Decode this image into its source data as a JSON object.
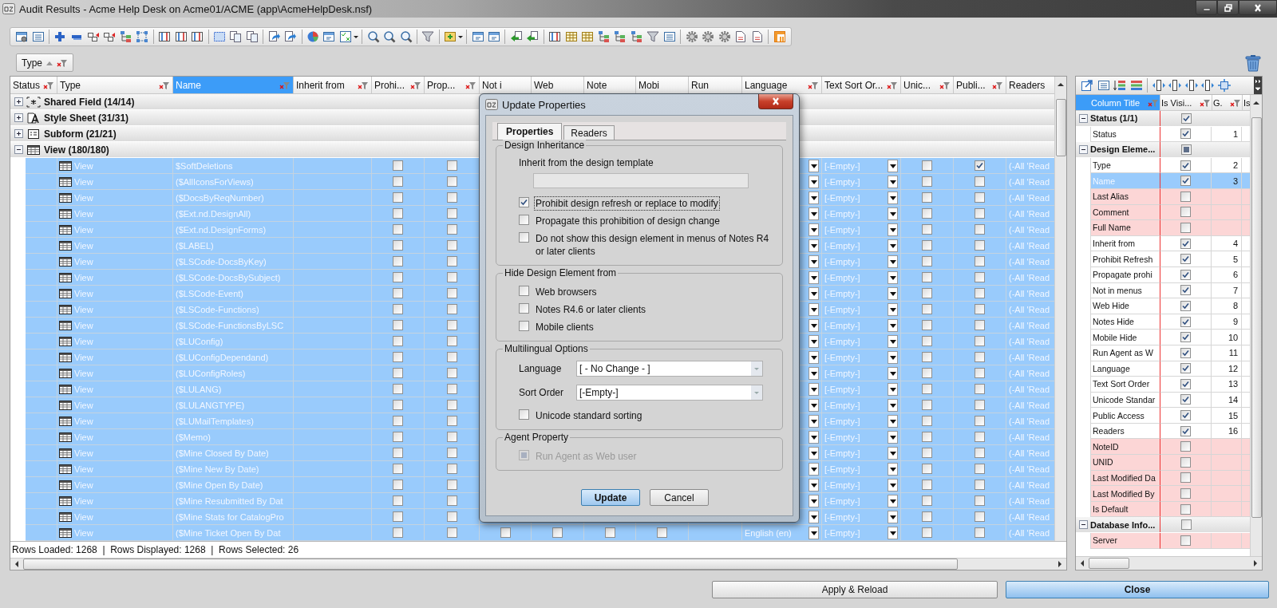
{
  "window": {
    "title": "Audit Results - Acme Help Desk on Acme01/ACME (app\\AcmeHelpDesk.nsf)"
  },
  "group_by": [
    {
      "label": "Type"
    }
  ],
  "table": {
    "columns": [
      {
        "label": "Status",
        "filter": true,
        "selected": false
      },
      {
        "label": "Type",
        "filter": true,
        "selected": false
      },
      {
        "label": "Name",
        "filter": true,
        "selected": true
      },
      {
        "label": "Inherit from",
        "filter": true,
        "selected": false
      },
      {
        "label": "Prohi...",
        "filter": true,
        "selected": false
      },
      {
        "label": "Prop...",
        "filter": true,
        "selected": false
      },
      {
        "label": "Not i",
        "filter": false,
        "selected": false
      },
      {
        "label": "Web",
        "filter": false,
        "selected": false
      },
      {
        "label": "Note",
        "filter": false,
        "selected": false
      },
      {
        "label": "Mobi",
        "filter": false,
        "selected": false
      },
      {
        "label": "Run",
        "filter": false,
        "selected": false
      },
      {
        "label": "Language",
        "filter": true,
        "selected": false
      },
      {
        "label": "Text Sort Or...",
        "filter": true,
        "selected": false
      },
      {
        "label": "Unic...",
        "filter": true,
        "selected": false
      },
      {
        "label": "Publi...",
        "filter": true,
        "selected": false
      },
      {
        "label": "Readers",
        "filter": false,
        "selected": false
      }
    ],
    "groups": [
      {
        "label": "Shared Field (14/14)",
        "expanded": false
      },
      {
        "label": "Style Sheet (31/31)",
        "expanded": false
      },
      {
        "label": "Subform (21/21)",
        "expanded": false
      },
      {
        "label": "View (180/180)",
        "expanded": true,
        "rows": [
          {
            "selected": true,
            "type": "View",
            "name": "$SoftDeletions",
            "prohibit": false,
            "propagate": false,
            "text_sort": "[-Empty-]",
            "unicode": false,
            "public": true,
            "readers": "(-All 'Read"
          },
          {
            "selected": true,
            "type": "View",
            "name": "($AllIconsForViews)",
            "prohibit": false,
            "propagate": false,
            "text_sort": "[-Empty-]",
            "unicode": false,
            "public": false,
            "readers": "(-All 'Read"
          },
          {
            "selected": true,
            "type": "View",
            "name": "($DocsByReqNumber)",
            "prohibit": false,
            "propagate": false,
            "text_sort": "[-Empty-]",
            "unicode": false,
            "public": false,
            "readers": "(-All 'Read"
          },
          {
            "selected": true,
            "type": "View",
            "name": "($Ext.nd.DesignAll)",
            "prohibit": false,
            "propagate": false,
            "text_sort": "[-Empty-]",
            "unicode": false,
            "public": false,
            "readers": "(-All 'Read"
          },
          {
            "selected": true,
            "type": "View",
            "name": "($Ext.nd.DesignForms)",
            "prohibit": false,
            "propagate": false,
            "text_sort": "[-Empty-]",
            "unicode": false,
            "public": false,
            "readers": "(-All 'Read"
          },
          {
            "selected": true,
            "type": "View",
            "name": "($LABEL)",
            "prohibit": false,
            "propagate": false,
            "text_sort": "[-Empty-]",
            "unicode": false,
            "public": false,
            "readers": "(-All 'Read"
          },
          {
            "selected": true,
            "type": "View",
            "name": "($LSCode-DocsByKey)",
            "prohibit": false,
            "propagate": false,
            "text_sort": "[-Empty-]",
            "unicode": false,
            "public": false,
            "readers": "(-All 'Read"
          },
          {
            "selected": true,
            "type": "View",
            "name": "($LSCode-DocsBySubject)",
            "prohibit": false,
            "propagate": false,
            "text_sort": "[-Empty-]",
            "unicode": false,
            "public": false,
            "readers": "(-All 'Read"
          },
          {
            "selected": true,
            "type": "View",
            "name": "($LSCode-Event)",
            "prohibit": false,
            "propagate": false,
            "text_sort": "[-Empty-]",
            "unicode": false,
            "public": false,
            "readers": "(-All 'Read"
          },
          {
            "selected": true,
            "type": "View",
            "name": "($LSCode-Functions)",
            "prohibit": false,
            "propagate": false,
            "text_sort": "[-Empty-]",
            "unicode": false,
            "public": false,
            "readers": "(-All 'Read"
          },
          {
            "selected": true,
            "type": "View",
            "name": "($LSCode-FunctionsByLSC",
            "prohibit": false,
            "propagate": false,
            "text_sort": "[-Empty-]",
            "unicode": false,
            "public": false,
            "readers": "(-All 'Read"
          },
          {
            "selected": true,
            "type": "View",
            "name": "($LUConfig)",
            "prohibit": false,
            "propagate": false,
            "text_sort": "[-Empty-]",
            "unicode": false,
            "public": false,
            "readers": "(-All 'Read"
          },
          {
            "selected": true,
            "type": "View",
            "name": "($LUConfigDependand)",
            "prohibit": false,
            "propagate": false,
            "text_sort": "[-Empty-]",
            "unicode": false,
            "public": false,
            "readers": "(-All 'Read"
          },
          {
            "selected": true,
            "type": "View",
            "name": "($LUConfigRoles)",
            "prohibit": false,
            "propagate": false,
            "text_sort": "[-Empty-]",
            "unicode": false,
            "public": false,
            "readers": "(-All 'Read"
          },
          {
            "selected": true,
            "type": "View",
            "name": "($LULANG)",
            "prohibit": false,
            "propagate": false,
            "text_sort": "[-Empty-]",
            "unicode": false,
            "public": false,
            "readers": "(-All 'Read"
          },
          {
            "selected": true,
            "type": "View",
            "name": "($LULANGTYPE)",
            "prohibit": false,
            "propagate": false,
            "text_sort": "[-Empty-]",
            "unicode": false,
            "public": false,
            "readers": "(-All 'Read"
          },
          {
            "selected": true,
            "type": "View",
            "name": "($LUMailTemplates)",
            "prohibit": false,
            "propagate": false,
            "text_sort": "[-Empty-]",
            "unicode": false,
            "public": false,
            "readers": "(-All 'Read"
          },
          {
            "selected": true,
            "type": "View",
            "name": "($Memo)",
            "prohibit": false,
            "propagate": false,
            "text_sort": "[-Empty-]",
            "unicode": false,
            "public": false,
            "readers": "(-All 'Read"
          },
          {
            "selected": true,
            "type": "View",
            "name": "($Mine Closed By Date)",
            "prohibit": false,
            "propagate": false,
            "text_sort": "[-Empty-]",
            "unicode": false,
            "public": false,
            "readers": "(-All 'Read"
          },
          {
            "selected": true,
            "type": "View",
            "name": "($Mine New By Date)",
            "prohibit": false,
            "propagate": false,
            "text_sort": "[-Empty-]",
            "unicode": false,
            "public": false,
            "readers": "(-All 'Read"
          },
          {
            "selected": true,
            "type": "View",
            "name": "($Mine Open By Date)",
            "prohibit": false,
            "propagate": false,
            "text_sort": "[-Empty-]",
            "unicode": false,
            "public": false,
            "readers": "(-All 'Read"
          },
          {
            "selected": true,
            "type": "View",
            "name": "($Mine Resubmitted By Dat",
            "prohibit": false,
            "propagate": false,
            "text_sort": "[-Empty-]",
            "unicode": false,
            "public": false,
            "readers": "(-All 'Read"
          },
          {
            "selected": true,
            "type": "View",
            "name": "($Mine Stats for CatalogPro",
            "prohibit": false,
            "propagate": false,
            "text_sort": "[-Empty-]",
            "unicode": false,
            "public": false,
            "readers": "(-All 'Read"
          },
          {
            "selected": true,
            "type": "View",
            "name": "($Mine Ticket Open By Dat",
            "prohibit": false,
            "propagate": false,
            "not_in_menus": false,
            "web_hide": false,
            "notes_hide": false,
            "mobile_hide": false,
            "language": "English (en)",
            "text_sort": "[-Empty-]",
            "unicode": false,
            "public": false,
            "readers": "(-All 'Read"
          }
        ]
      }
    ],
    "status": "Rows Loaded: 1268  |  Rows Displayed: 1268  |  Rows Selected: 26"
  },
  "columns_panel": {
    "columns": [
      {
        "label": "Column Title",
        "filter": true,
        "selected": true
      },
      {
        "label": "Is Visi...",
        "filter": true,
        "selected": false
      },
      {
        "label": "G.",
        "filter": true,
        "selected": false
      },
      {
        "label": "Is",
        "selected": false
      }
    ],
    "groups": [
      {
        "label": "Status (1/1)",
        "expanded": true,
        "checked": true,
        "mixed": false,
        "children": [
          {
            "label": "Status",
            "visible": true,
            "order": "1",
            "selected": false
          }
        ]
      },
      {
        "label": "Design Eleme...",
        "expanded": true,
        "checked": false,
        "mixed": true,
        "children": [
          {
            "label": "Type",
            "visible": true,
            "order": "2",
            "selected": false
          },
          {
            "label": "Name",
            "visible": true,
            "order": "3",
            "selected": true
          },
          {
            "label": "Last Alias",
            "visible": false,
            "selected": false
          },
          {
            "label": "Comment",
            "visible": false,
            "selected": false
          },
          {
            "label": "Full Name",
            "visible": false,
            "selected": false
          },
          {
            "label": "Inherit from",
            "visible": true,
            "order": "4",
            "selected": false
          },
          {
            "label": "Prohibit Refresh",
            "visible": true,
            "order": "5",
            "selected": false
          },
          {
            "label": "Propagate prohi",
            "visible": true,
            "order": "6",
            "selected": false
          },
          {
            "label": "Not in menus",
            "visible": true,
            "order": "7",
            "selected": false
          },
          {
            "label": "Web Hide",
            "visible": true,
            "order": "8",
            "selected": false
          },
          {
            "label": "Notes Hide",
            "visible": true,
            "order": "9",
            "selected": false
          },
          {
            "label": "Mobile Hide",
            "visible": true,
            "order": "10",
            "selected": false
          },
          {
            "label": "Run Agent as W",
            "visible": true,
            "order": "11",
            "selected": false
          },
          {
            "label": "Language",
            "visible": true,
            "order": "12",
            "selected": false
          },
          {
            "label": "Text Sort Order",
            "visible": true,
            "order": "13",
            "selected": false
          },
          {
            "label": "Unicode Standar",
            "visible": true,
            "order": "14",
            "selected": false
          },
          {
            "label": "Public Access",
            "visible": true,
            "order": "15",
            "selected": false
          },
          {
            "label": "Readers",
            "visible": true,
            "order": "16",
            "selected": false
          },
          {
            "label": "NoteID",
            "visible": false,
            "selected": false
          },
          {
            "label": "UNID",
            "visible": false,
            "selected": false
          },
          {
            "label": "Last Modified Da",
            "visible": false,
            "selected": false
          },
          {
            "label": "Last Modified By",
            "visible": false,
            "selected": false
          },
          {
            "label": "Is Default",
            "visible": false,
            "selected": false
          }
        ]
      },
      {
        "label": "Database Info...",
        "expanded": true,
        "checked": false,
        "mixed": false,
        "children": [
          {
            "label": "Server",
            "visible": false,
            "selected": false
          }
        ]
      }
    ]
  },
  "dialog": {
    "title": "Update Properties",
    "tabs": [
      {
        "label": "Properties",
        "selected": true
      },
      {
        "label": "Readers",
        "selected": false
      }
    ],
    "sections": [
      {
        "title": "Design Inheritance",
        "items": [
          {
            "kind": "field",
            "label": "Inherit from the design template"
          },
          {
            "kind": "checkbox",
            "label": "Prohibit design refresh or replace to modify",
            "checked": true,
            "disabled": false,
            "focused": true
          },
          {
            "kind": "checkbox",
            "label": "Propagate this prohibition of design change",
            "checked": false,
            "disabled": false,
            "focused": false
          },
          {
            "kind": "checkbox",
            "label": "Do not show this design element in menus of Notes R4 or later clients",
            "checked": false,
            "disabled": false,
            "focused": false
          }
        ]
      },
      {
        "title": "Hide Design Element from",
        "items": [
          {
            "kind": "checkbox",
            "label": "Web browsers",
            "checked": false,
            "disabled": false,
            "focused": false
          },
          {
            "kind": "checkbox",
            "label": "Notes R4.6 or later clients",
            "checked": false,
            "disabled": false,
            "focused": false
          },
          {
            "kind": "checkbox",
            "label": "Mobile clients",
            "checked": false,
            "disabled": false,
            "focused": false
          }
        ]
      },
      {
        "title": "Multilingual Options",
        "items": [
          {
            "kind": "select",
            "label": "Language",
            "value": "[ - No Change - ]"
          },
          {
            "kind": "select",
            "label": "Sort Order",
            "value": "[-Empty-]"
          },
          {
            "kind": "checkbox",
            "label": "Unicode standard sorting",
            "checked": false,
            "disabled": false,
            "focused": false
          }
        ]
      },
      {
        "title": "Agent Property",
        "items": [
          {
            "kind": "checkbox",
            "label": "Run Agent as Web user",
            "checked": false,
            "disabled": true,
            "focused": false
          }
        ]
      }
    ],
    "buttons": [
      {
        "label": "Update",
        "default": true
      },
      {
        "label": "Cancel",
        "default": false
      }
    ]
  },
  "footer_buttons": [
    {
      "label": "Apply & Reload",
      "default": false
    },
    {
      "label": "Close",
      "default": true
    }
  ]
}
